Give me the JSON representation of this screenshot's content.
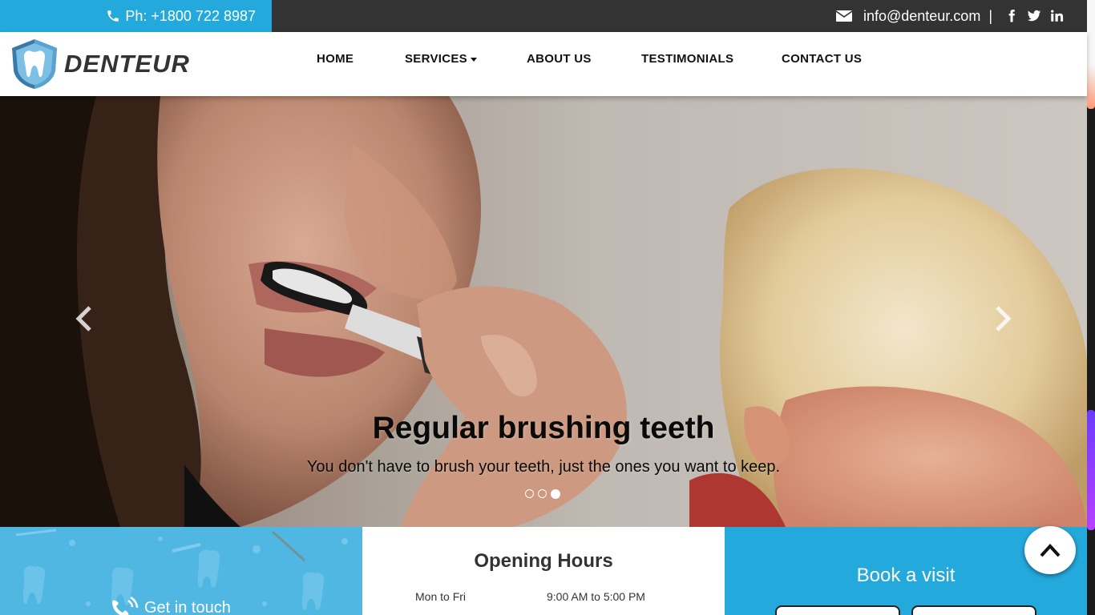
{
  "topbar": {
    "phone": "Ph: +1800 722 8987",
    "email": "info@denteur.com",
    "separator": "|",
    "social": [
      "facebook-icon",
      "twitter-icon",
      "linkedin-icon"
    ]
  },
  "brand": {
    "name": "DENTEUR"
  },
  "nav": {
    "items": [
      "HOME",
      "SERVICES",
      "ABOUT US",
      "TESTIMONIALS",
      "CONTACT US"
    ]
  },
  "hero": {
    "title": "Regular brushing teeth",
    "subtitle": "You don't have to brush your teeth, just the ones you want to keep.",
    "slide_count": 3,
    "active_slide": 3
  },
  "panels": {
    "contact": {
      "label": "Get in touch"
    },
    "hours": {
      "title": "Opening Hours",
      "rows": [
        {
          "day": "Mon to Fri",
          "time": "9:00 AM to 5:00 PM"
        }
      ]
    },
    "book": {
      "title": "Book a visit"
    }
  },
  "colors": {
    "accent": "#24a9dc",
    "topbar_bg": "#333333",
    "text_dark": "#333333"
  }
}
